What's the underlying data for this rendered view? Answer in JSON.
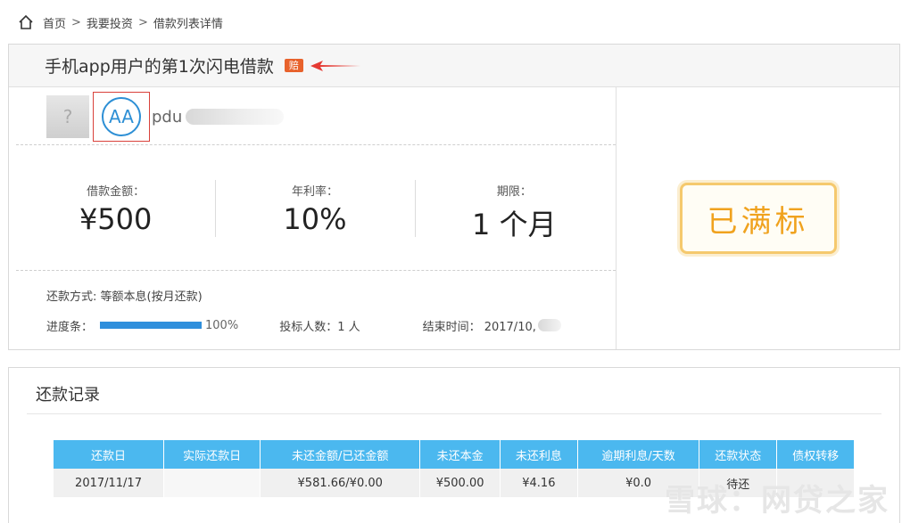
{
  "breadcrumb": {
    "home": "首页",
    "sep": ">",
    "invest": "我要投资",
    "detail": "借款列表详情"
  },
  "loan": {
    "title": "手机app用户的第1次闪电借款",
    "badge": "赔",
    "user": "pdu",
    "avatar_text": "AA",
    "stats": [
      {
        "label": "借款金额：",
        "value": "¥500"
      },
      {
        "label": "年利率：",
        "value": "10%"
      },
      {
        "label": "期限：",
        "value": "1 个月"
      }
    ],
    "repay_method": "还款方式: 等额本息(按月还款)",
    "progress_label": "进度条：",
    "progress_pct": "100%",
    "bidders": "投标人数：1 人",
    "end_time": "结束时间： 2017/10,",
    "status": "已满标"
  },
  "colors": {
    "accent": "#2f8fdc",
    "badge": "#e8622c",
    "stamp": "#f0a21e",
    "table_head": "#4bb8ef"
  },
  "repay_records": {
    "title": "还款记录",
    "headers": [
      "还款日",
      "实际还款日",
      "未还金额/已还金额",
      "未还本金",
      "未还利息",
      "逾期利息/天数",
      "还款状态",
      "债权转移"
    ],
    "rows": [
      [
        "2017/11/17",
        "",
        "¥581.66/¥0.00",
        "¥500.00",
        "¥4.16",
        "¥0.0",
        "待还",
        ""
      ]
    ]
  },
  "watermark": "雪球：网贷之家"
}
